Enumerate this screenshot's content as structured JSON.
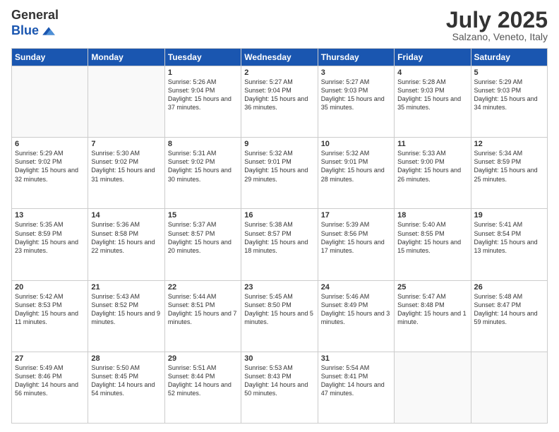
{
  "logo": {
    "general": "General",
    "blue": "Blue"
  },
  "header": {
    "month": "July 2025",
    "location": "Salzano, Veneto, Italy"
  },
  "weekdays": [
    "Sunday",
    "Monday",
    "Tuesday",
    "Wednesday",
    "Thursday",
    "Friday",
    "Saturday"
  ],
  "weeks": [
    [
      {
        "day": "",
        "info": ""
      },
      {
        "day": "",
        "info": ""
      },
      {
        "day": "1",
        "info": "Sunrise: 5:26 AM\nSunset: 9:04 PM\nDaylight: 15 hours and 37 minutes."
      },
      {
        "day": "2",
        "info": "Sunrise: 5:27 AM\nSunset: 9:04 PM\nDaylight: 15 hours and 36 minutes."
      },
      {
        "day": "3",
        "info": "Sunrise: 5:27 AM\nSunset: 9:03 PM\nDaylight: 15 hours and 35 minutes."
      },
      {
        "day": "4",
        "info": "Sunrise: 5:28 AM\nSunset: 9:03 PM\nDaylight: 15 hours and 35 minutes."
      },
      {
        "day": "5",
        "info": "Sunrise: 5:29 AM\nSunset: 9:03 PM\nDaylight: 15 hours and 34 minutes."
      }
    ],
    [
      {
        "day": "6",
        "info": "Sunrise: 5:29 AM\nSunset: 9:02 PM\nDaylight: 15 hours and 32 minutes."
      },
      {
        "day": "7",
        "info": "Sunrise: 5:30 AM\nSunset: 9:02 PM\nDaylight: 15 hours and 31 minutes."
      },
      {
        "day": "8",
        "info": "Sunrise: 5:31 AM\nSunset: 9:02 PM\nDaylight: 15 hours and 30 minutes."
      },
      {
        "day": "9",
        "info": "Sunrise: 5:32 AM\nSunset: 9:01 PM\nDaylight: 15 hours and 29 minutes."
      },
      {
        "day": "10",
        "info": "Sunrise: 5:32 AM\nSunset: 9:01 PM\nDaylight: 15 hours and 28 minutes."
      },
      {
        "day": "11",
        "info": "Sunrise: 5:33 AM\nSunset: 9:00 PM\nDaylight: 15 hours and 26 minutes."
      },
      {
        "day": "12",
        "info": "Sunrise: 5:34 AM\nSunset: 8:59 PM\nDaylight: 15 hours and 25 minutes."
      }
    ],
    [
      {
        "day": "13",
        "info": "Sunrise: 5:35 AM\nSunset: 8:59 PM\nDaylight: 15 hours and 23 minutes."
      },
      {
        "day": "14",
        "info": "Sunrise: 5:36 AM\nSunset: 8:58 PM\nDaylight: 15 hours and 22 minutes."
      },
      {
        "day": "15",
        "info": "Sunrise: 5:37 AM\nSunset: 8:57 PM\nDaylight: 15 hours and 20 minutes."
      },
      {
        "day": "16",
        "info": "Sunrise: 5:38 AM\nSunset: 8:57 PM\nDaylight: 15 hours and 18 minutes."
      },
      {
        "day": "17",
        "info": "Sunrise: 5:39 AM\nSunset: 8:56 PM\nDaylight: 15 hours and 17 minutes."
      },
      {
        "day": "18",
        "info": "Sunrise: 5:40 AM\nSunset: 8:55 PM\nDaylight: 15 hours and 15 minutes."
      },
      {
        "day": "19",
        "info": "Sunrise: 5:41 AM\nSunset: 8:54 PM\nDaylight: 15 hours and 13 minutes."
      }
    ],
    [
      {
        "day": "20",
        "info": "Sunrise: 5:42 AM\nSunset: 8:53 PM\nDaylight: 15 hours and 11 minutes."
      },
      {
        "day": "21",
        "info": "Sunrise: 5:43 AM\nSunset: 8:52 PM\nDaylight: 15 hours and 9 minutes."
      },
      {
        "day": "22",
        "info": "Sunrise: 5:44 AM\nSunset: 8:51 PM\nDaylight: 15 hours and 7 minutes."
      },
      {
        "day": "23",
        "info": "Sunrise: 5:45 AM\nSunset: 8:50 PM\nDaylight: 15 hours and 5 minutes."
      },
      {
        "day": "24",
        "info": "Sunrise: 5:46 AM\nSunset: 8:49 PM\nDaylight: 15 hours and 3 minutes."
      },
      {
        "day": "25",
        "info": "Sunrise: 5:47 AM\nSunset: 8:48 PM\nDaylight: 15 hours and 1 minute."
      },
      {
        "day": "26",
        "info": "Sunrise: 5:48 AM\nSunset: 8:47 PM\nDaylight: 14 hours and 59 minutes."
      }
    ],
    [
      {
        "day": "27",
        "info": "Sunrise: 5:49 AM\nSunset: 8:46 PM\nDaylight: 14 hours and 56 minutes."
      },
      {
        "day": "28",
        "info": "Sunrise: 5:50 AM\nSunset: 8:45 PM\nDaylight: 14 hours and 54 minutes."
      },
      {
        "day": "29",
        "info": "Sunrise: 5:51 AM\nSunset: 8:44 PM\nDaylight: 14 hours and 52 minutes."
      },
      {
        "day": "30",
        "info": "Sunrise: 5:53 AM\nSunset: 8:43 PM\nDaylight: 14 hours and 50 minutes."
      },
      {
        "day": "31",
        "info": "Sunrise: 5:54 AM\nSunset: 8:41 PM\nDaylight: 14 hours and 47 minutes."
      },
      {
        "day": "",
        "info": ""
      },
      {
        "day": "",
        "info": ""
      }
    ]
  ]
}
